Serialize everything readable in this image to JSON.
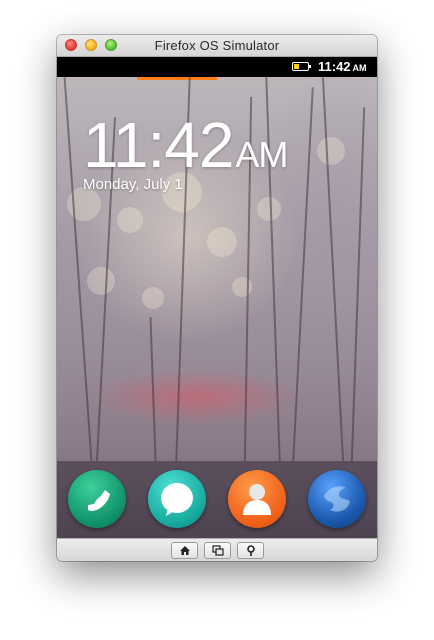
{
  "window": {
    "title": "Firefox OS Simulator"
  },
  "statusbar": {
    "time": "11:42",
    "ampm": "AM",
    "battery_level": 0.35,
    "battery_color": "#ffd400"
  },
  "lockscreen": {
    "clock": "11:42",
    "clock_ampm": "AM",
    "date": "Monday, July 1",
    "indicator_color": "#ff7f1a"
  },
  "dock": {
    "apps": [
      {
        "icon": "phone-icon",
        "color": "#1aa37a"
      },
      {
        "icon": "messages-icon",
        "color": "#1bb0a8"
      },
      {
        "icon": "contacts-icon",
        "color": "#f06a1e"
      },
      {
        "icon": "browser-icon",
        "color": "#1f5aa8"
      }
    ]
  },
  "simulator_buttons": [
    {
      "icon": "home-icon"
    },
    {
      "icon": "card-view-icon"
    },
    {
      "icon": "location-icon"
    }
  ]
}
